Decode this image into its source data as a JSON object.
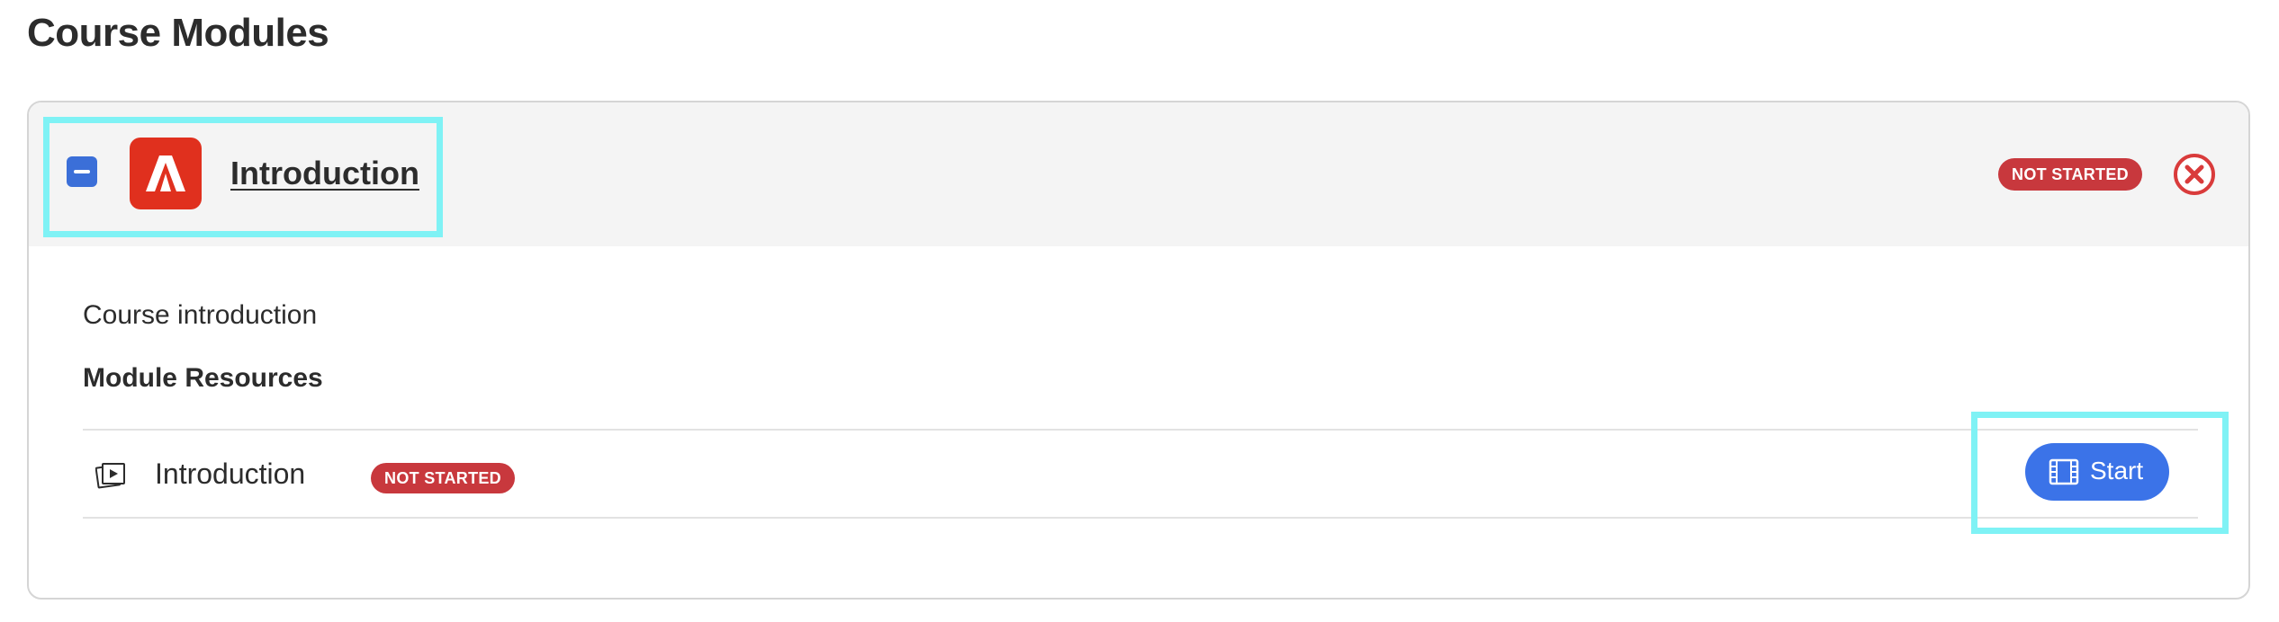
{
  "page": {
    "title": "Course Modules"
  },
  "module": {
    "title": "Introduction",
    "status": "NOT STARTED",
    "description": "Course introduction",
    "resources_heading": "Module Resources",
    "resources": [
      {
        "title": "Introduction",
        "status": "NOT STARTED",
        "action_label": "Start",
        "icon": "video-resource-icon"
      }
    ]
  },
  "icons": {
    "collapse": "minus-square-icon",
    "logo": "adobe-logo-icon",
    "remove": "close-circle-icon",
    "start": "film-icon"
  },
  "colors": {
    "accent": "#3b73e8",
    "status_not_started": "#c8383d",
    "logo_red": "#e0301e",
    "remove_red": "#d93b3b",
    "highlight": "#7ff2f5"
  }
}
